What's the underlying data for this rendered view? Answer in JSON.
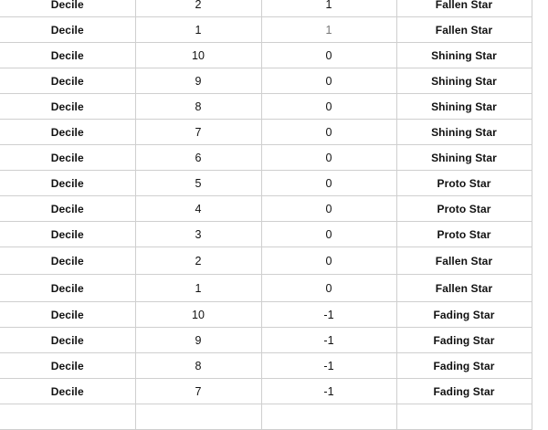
{
  "rows": [
    {
      "label": "Decile",
      "decile": "2",
      "score": "1",
      "category": "Fallen Star"
    },
    {
      "label": "Decile",
      "decile": "1",
      "score": "1",
      "category": "Fallen Star"
    },
    {
      "label": "Decile",
      "decile": "10",
      "score": "0",
      "category": "Shining Star"
    },
    {
      "label": "Decile",
      "decile": "9",
      "score": "0",
      "category": "Shining Star"
    },
    {
      "label": "Decile",
      "decile": "8",
      "score": "0",
      "category": "Shining Star"
    },
    {
      "label": "Decile",
      "decile": "7",
      "score": "0",
      "category": "Shining Star"
    },
    {
      "label": "Decile",
      "decile": "6",
      "score": "0",
      "category": "Shining Star"
    },
    {
      "label": "Decile",
      "decile": "5",
      "score": "0",
      "category": "Proto Star"
    },
    {
      "label": "Decile",
      "decile": "4",
      "score": "0",
      "category": "Proto Star"
    },
    {
      "label": "Decile",
      "decile": "3",
      "score": "0",
      "category": "Proto Star"
    },
    {
      "label": "Decile",
      "decile": "2",
      "score": "0",
      "category": "Fallen Star"
    },
    {
      "label": "Decile",
      "decile": "1",
      "score": "0",
      "category": "Fallen Star"
    },
    {
      "label": "Decile",
      "decile": "10",
      "score": "-1",
      "category": "Fading Star"
    },
    {
      "label": "Decile",
      "decile": "9",
      "score": "-1",
      "category": "Fading Star"
    },
    {
      "label": "Decile",
      "decile": "8",
      "score": "-1",
      "category": "Fading Star"
    },
    {
      "label": "Decile",
      "decile": "7",
      "score": "-1",
      "category": "Fading Star"
    },
    {
      "label": "",
      "decile": "",
      "score": "",
      "category": ""
    }
  ]
}
